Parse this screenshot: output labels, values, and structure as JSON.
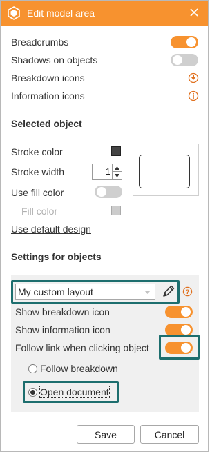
{
  "dialog": {
    "title": "Edit model area",
    "accent_color": "#f7922f",
    "highlight_color": "#1d6e6e"
  },
  "general": {
    "breadcrumbs_label": "Breadcrumbs",
    "breadcrumbs_on": true,
    "shadows_label": "Shadows on objects",
    "shadows_on": false,
    "breakdown_icons_label": "Breakdown icons",
    "breakdown_icon": "down-arrow-circle-icon",
    "information_icons_label": "Information icons",
    "information_icon": "info-circle-icon"
  },
  "selected_object": {
    "section_title": "Selected object",
    "stroke_color_label": "Stroke color",
    "stroke_color": "#444444",
    "stroke_width_label": "Stroke width",
    "stroke_width_value": "1",
    "use_fill_color_label": "Use fill color",
    "use_fill_color_on": false,
    "fill_color_label": "Fill color",
    "fill_color": "#cccccc",
    "default_design_link": "Use default design"
  },
  "settings": {
    "section_title": "Settings for objects",
    "layout_value": "My custom layout",
    "show_breakdown_label": "Show breakdown icon",
    "show_breakdown_on": true,
    "show_information_label": "Show information icon",
    "show_information_on": true,
    "follow_link_label": "Follow link when clicking object",
    "follow_link_on": true,
    "radio_options": [
      "Follow breakdown",
      "Open document"
    ],
    "radio_selected": "Open document"
  },
  "footer": {
    "save_label": "Save",
    "cancel_label": "Cancel"
  }
}
